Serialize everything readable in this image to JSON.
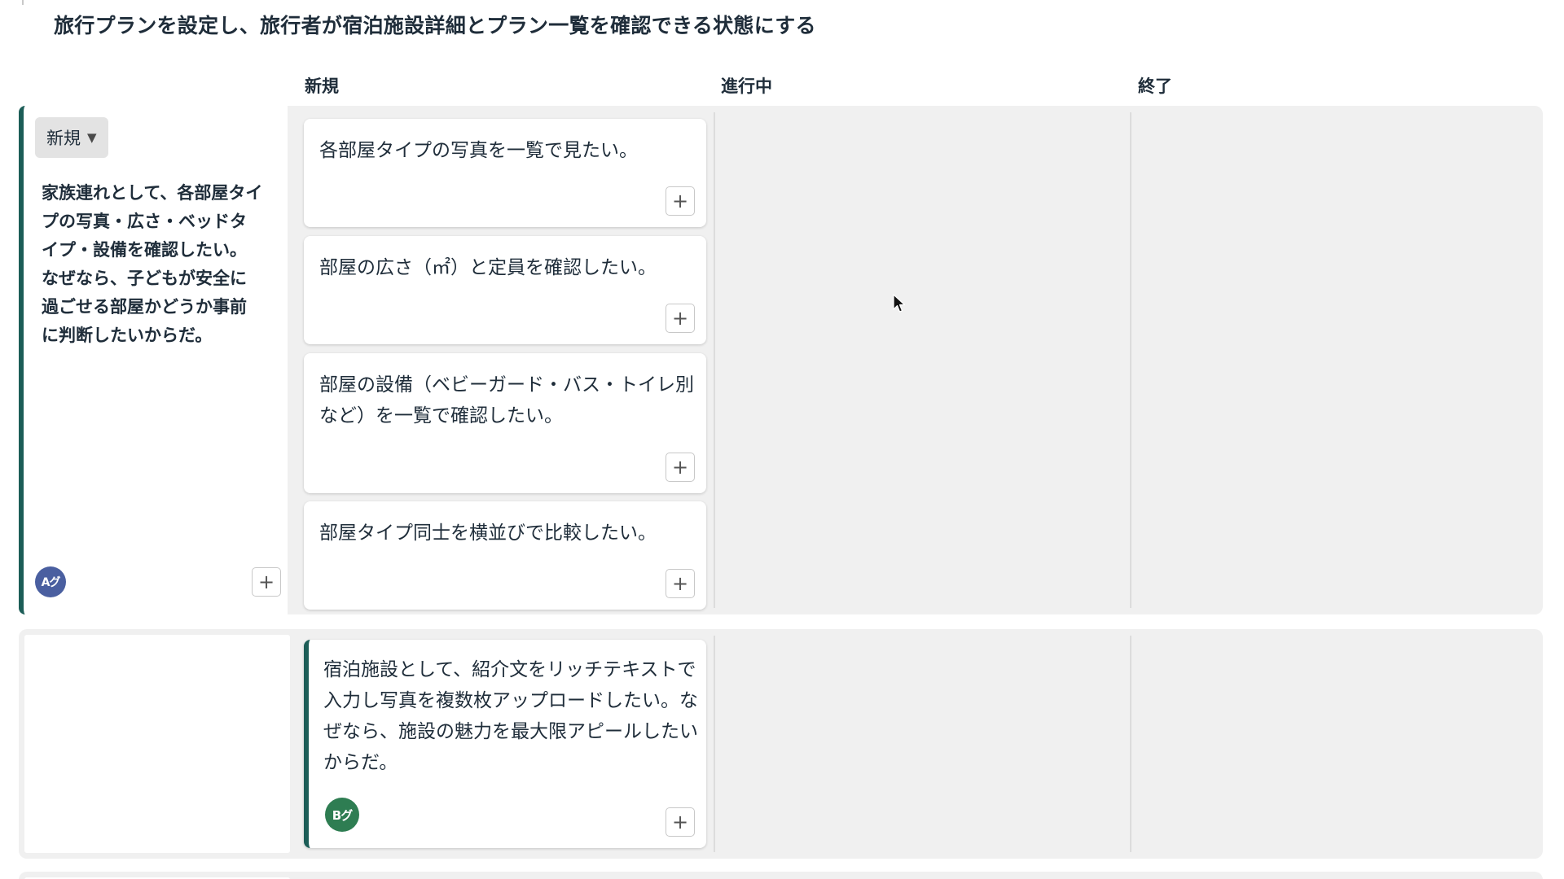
{
  "page": {
    "title": "旅行プランを設定し、旅行者が宿泊施設詳細とプラン一覧を確認できる状態にする"
  },
  "columns": {
    "new": "新規",
    "in_progress": "進行中",
    "done": "終了"
  },
  "lane1": {
    "status_label": "新規",
    "status_icon": "caret-down-icon",
    "story": "家族連れとして、各部屋タイプの写真・広さ・ベッドタイプ・設備を確認したい。なぜなら、子どもが安全に過ごせる部屋かどうか事前に判断したいからだ。",
    "avatar": "Aグ",
    "add_label": "+",
    "cards": [
      {
        "text": "各部屋タイプの写真を一覧で見たい。",
        "add_label": "+"
      },
      {
        "text": "部屋の広さ（㎡）と定員を確認したい。",
        "add_label": "+"
      },
      {
        "text": "部屋の設備（ベビーガード・バス・トイレ別など）を一覧で確認したい。",
        "add_label": "+"
      },
      {
        "text": "部屋タイプ同士を横並びで比較したい。",
        "add_label": "+"
      }
    ]
  },
  "lane2": {
    "card": {
      "text": "宿泊施設として、紹介文をリッチテキストで入力し写真を複数枚アップロードしたい。なぜなら、施設の魅力を最大限アピールしたいからだ。",
      "avatar": "Bグ",
      "add_label": "+"
    }
  },
  "colors": {
    "accent": "#1c5d57",
    "lane_bg": "#f0f0f0",
    "avatar_a": "#4a5fa0",
    "avatar_b": "#2e7d52"
  }
}
